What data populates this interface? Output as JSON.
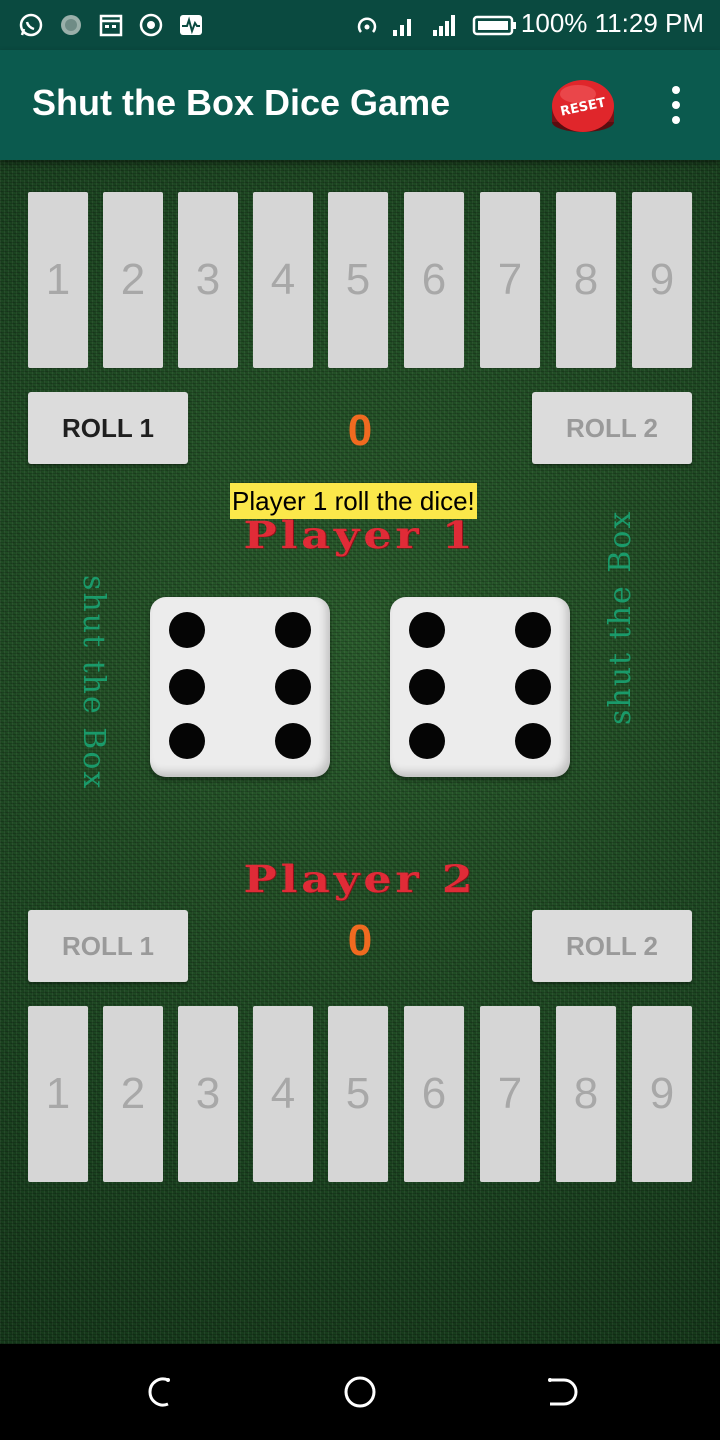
{
  "status_bar": {
    "battery_percent": "100%",
    "time": "11:29 PM",
    "icons": [
      "whatsapp-icon",
      "app-icon",
      "calendar-icon",
      "record-icon",
      "activity-icon",
      "hotspot-icon",
      "signal-icon",
      "signal-icon",
      "battery-icon"
    ]
  },
  "app_bar": {
    "title": "Shut the Box Dice Game",
    "reset_label": "RESET",
    "menu_icon": "more-vert-icon"
  },
  "game": {
    "top_tiles": [
      "1",
      "2",
      "3",
      "4",
      "5",
      "6",
      "7",
      "8",
      "9"
    ],
    "bottom_tiles": [
      "1",
      "2",
      "3",
      "4",
      "5",
      "6",
      "7",
      "8",
      "9"
    ],
    "player1": {
      "title": "Player 1",
      "score": "0",
      "roll1_label": "ROLL 1",
      "roll2_label": "ROLL 2"
    },
    "player2": {
      "title": "Player 2",
      "score": "0",
      "roll1_label": "ROLL 1",
      "roll2_label": "ROLL 2"
    },
    "status_message": "Player 1 roll the dice!",
    "side_logo_text": "shut the Box",
    "dice": [
      6,
      6
    ]
  },
  "colors": {
    "app_bar": "#0b5a4e",
    "status_bar": "#0a4a40",
    "felt": "#1e4a22",
    "score": "#f06a20",
    "player_title": "#e02b37",
    "status_highlight": "#fbe84a",
    "side_logo": "#1a9a6a"
  },
  "nav_bar": {
    "icons": [
      "back-icon",
      "home-icon",
      "recents-icon"
    ]
  }
}
